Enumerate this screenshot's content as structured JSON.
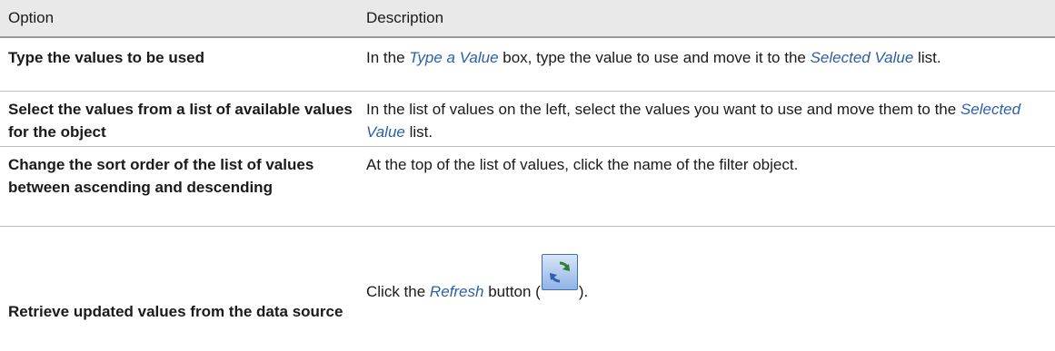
{
  "table": {
    "headers": {
      "option": "Option",
      "description": "Description"
    },
    "rows": [
      {
        "option": "Type the values to be used",
        "desc_pre": "In the ",
        "desc_term1": "Type a Value",
        "desc_mid": " box, type the value to use and move it to the ",
        "desc_term2": "Selected Value",
        "desc_post": " list."
      },
      {
        "option": "Select the values from a list of available values for the object",
        "desc_pre": "In the list of values on the left, select the values you want to use and move them to the ",
        "desc_term1": "Selected Value",
        "desc_post": " list."
      },
      {
        "option": "Change the sort order of the list of values between ascending and descending",
        "desc": "At the top of the list of values, click the name of the filter object."
      },
      {
        "option": "Retrieve updated values from the data source",
        "desc_pre": "Click the ",
        "desc_term1": "Refresh",
        "desc_mid": " button (",
        "desc_post": ").",
        "icon": "refresh-icon"
      }
    ]
  },
  "colors": {
    "header_bg": "#e9e9e9",
    "term": "#2b5fa8",
    "row_border": "#bdbdbd"
  }
}
